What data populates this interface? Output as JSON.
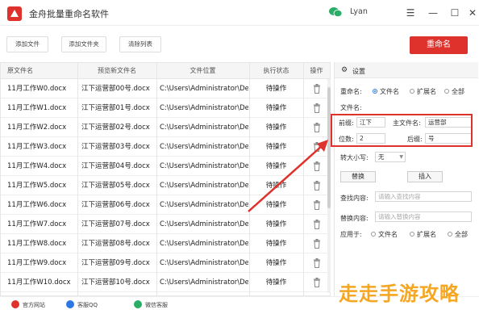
{
  "app": {
    "title": "金舟批量重命名软件",
    "user": "Lyan"
  },
  "toolbar": {
    "add_file": "添加文件",
    "add_folder": "添加文件夹",
    "clear_list": "清除列表",
    "rename": "重命名"
  },
  "table": {
    "headers": [
      "原文件名",
      "预览新文件名",
      "文件位置",
      "执行状态",
      "操作"
    ],
    "rows": [
      [
        "11月工作W0.docx",
        "江下运营部00号.docx",
        "C:\\Users\\Administrator\\De...",
        "待操作"
      ],
      [
        "11月工作W1.docx",
        "江下运营部01号.docx",
        "C:\\Users\\Administrator\\De...",
        "待操作"
      ],
      [
        "11月工作W2.docx",
        "江下运营部02号.docx",
        "C:\\Users\\Administrator\\De...",
        "待操作"
      ],
      [
        "11月工作W3.docx",
        "江下运营部03号.docx",
        "C:\\Users\\Administrator\\De...",
        "待操作"
      ],
      [
        "11月工作W4.docx",
        "江下运营部04号.docx",
        "C:\\Users\\Administrator\\De...",
        "待操作"
      ],
      [
        "11月工作W5.docx",
        "江下运营部05号.docx",
        "C:\\Users\\Administrator\\De...",
        "待操作"
      ],
      [
        "11月工作W6.docx",
        "江下运营部06号.docx",
        "C:\\Users\\Administrator\\De...",
        "待操作"
      ],
      [
        "11月工作W7.docx",
        "江下运营部07号.docx",
        "C:\\Users\\Administrator\\De...",
        "待操作"
      ],
      [
        "11月工作W8.docx",
        "江下运营部08号.docx",
        "C:\\Users\\Administrator\\De...",
        "待操作"
      ],
      [
        "11月工作W9.docx",
        "江下运营部09号.docx",
        "C:\\Users\\Administrator\\De...",
        "待操作"
      ],
      [
        "11月工作W10.docx",
        "江下运营部10号.docx",
        "C:\\Users\\Administrator\\De...",
        "待操作"
      ]
    ]
  },
  "settings": {
    "title": "设置",
    "rename_label": "重命名:",
    "rename_opts": [
      "文件名",
      "扩展名",
      "全部"
    ],
    "filename_label": "文件名:",
    "prefix_label": "前缀:",
    "prefix_value": "江下",
    "main_label": "主文件名:",
    "main_value": "运营部",
    "digits_label": "位数:",
    "digits_value": "2",
    "suffix_label": "后缀:",
    "suffix_value": "号",
    "case_label": "转大小写:",
    "case_value": "无",
    "replace_btn": "替换",
    "insert_btn": "插入",
    "find_label": "查找内容:",
    "find_placeholder": "请输入查找内容",
    "replace_label": "替换内容:",
    "replace_placeholder": "请输入替换内容",
    "apply_label": "应用于:",
    "apply_opts": [
      "文件名",
      "扩展名",
      "全部"
    ]
  },
  "footer": {
    "site": "官方网站",
    "qq": "客服QQ",
    "wechat": "微信客服"
  },
  "watermark": "走走手游攻略",
  "colors": {
    "accent": "#e0322c",
    "radio": "#2b78e4"
  }
}
